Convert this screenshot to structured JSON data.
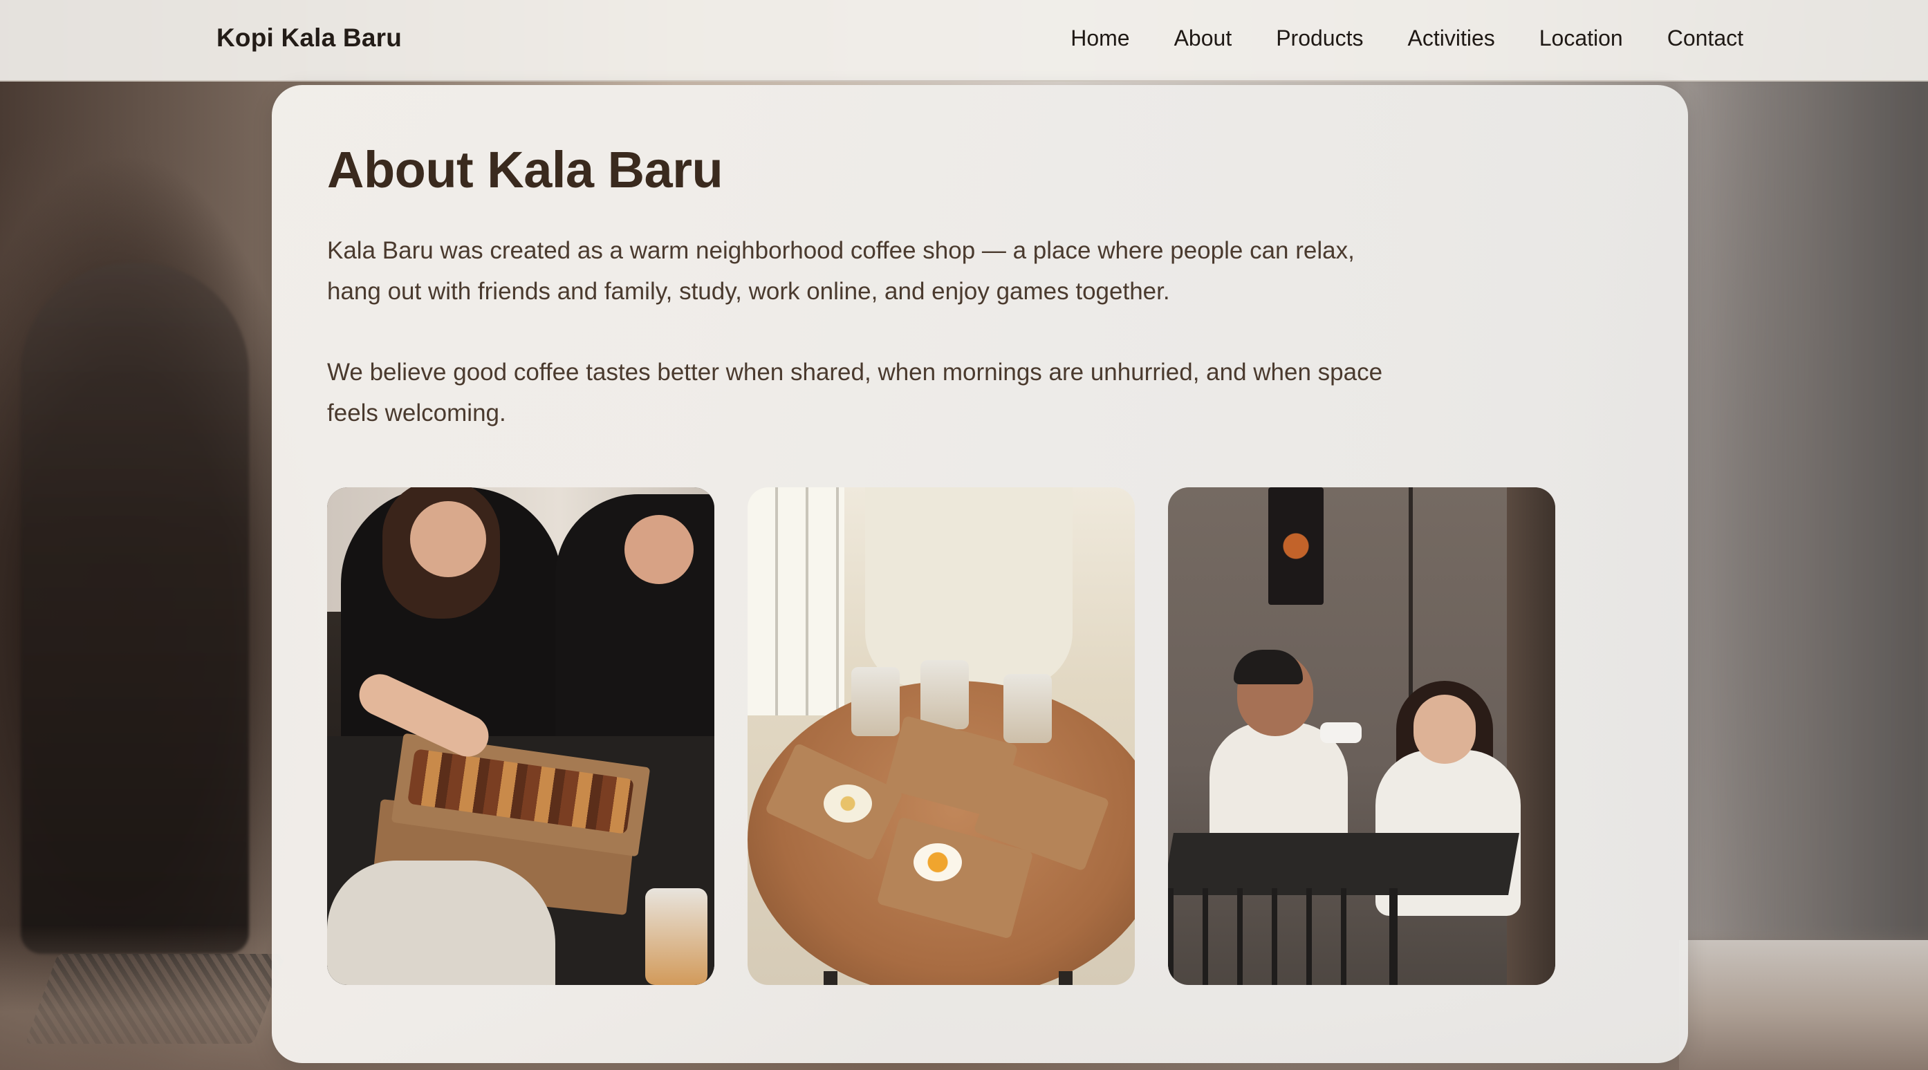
{
  "header": {
    "brand": "Kopi Kala Baru",
    "nav": [
      "Home",
      "About",
      "Products",
      "Activities",
      "Location",
      "Contact"
    ]
  },
  "about": {
    "title": "About Kala Baru",
    "paragraph1": "Kala Baru was created as a warm neighborhood coffee shop — a place where people can relax, hang out with friends and family, study, work online, and enjoy games together.",
    "paragraph2": "We believe good coffee tastes better when shared, when mornings are unhurried, and when space feels welcoming."
  },
  "colors": {
    "title": "#3a2a1e",
    "body_text": "#4a3a2e",
    "brand": "#231c17"
  }
}
